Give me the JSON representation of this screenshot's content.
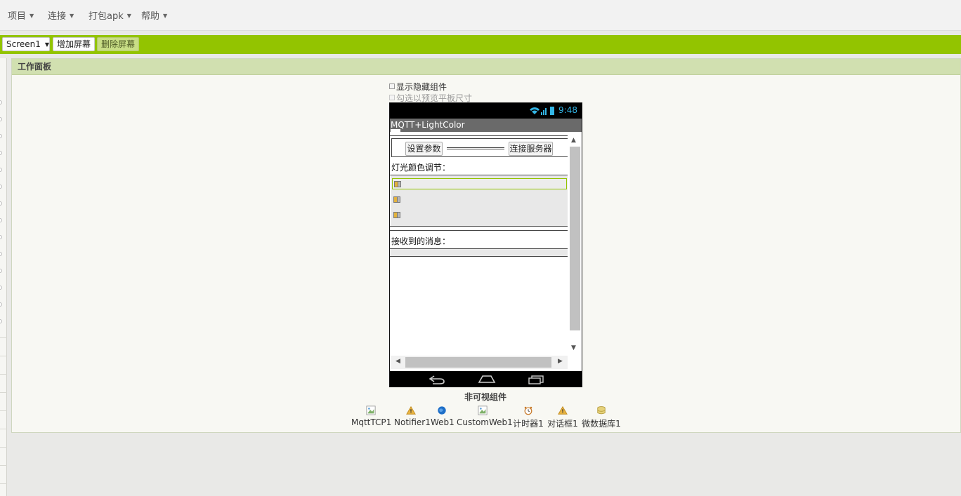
{
  "menu": [
    {
      "label": "项目"
    },
    {
      "label": "连接"
    },
    {
      "label": "打包apk"
    },
    {
      "label": "帮助"
    }
  ],
  "toolbar": {
    "screen_select": "Screen1",
    "add_screen": "增加屏幕",
    "remove_screen": "删除屏幕"
  },
  "viewer": {
    "title": "工作面板",
    "show_hidden": "显示隐藏组件",
    "tablet_preview": "勾选以预览平板尺寸",
    "phone": {
      "time": "9:48",
      "app_title": "MQTT+LightColor",
      "btn_settings": "设置参数",
      "btn_connect": "连接服务器",
      "label_color": "灯光颜色调节：",
      "label_received": "接收到的消息："
    },
    "nonvisible_title": "非可视组件",
    "nonvisible": [
      {
        "name": "MqttTCP1",
        "icon": "broken-image-icon"
      },
      {
        "name": "Notifier1",
        "icon": "warning-icon"
      },
      {
        "name": "Web1",
        "icon": "globe-icon"
      },
      {
        "name": "CustomWeb1",
        "icon": "broken-image-icon"
      },
      {
        "name": "计时器1",
        "icon": "clock-icon"
      },
      {
        "name": "对话框1",
        "icon": "warning-icon"
      },
      {
        "name": "微数据库1",
        "icon": "database-icon"
      }
    ]
  },
  "colors": {
    "accent": "#93c400",
    "panel_header": "#d1e0b0",
    "status_time": "#33b5e5"
  }
}
